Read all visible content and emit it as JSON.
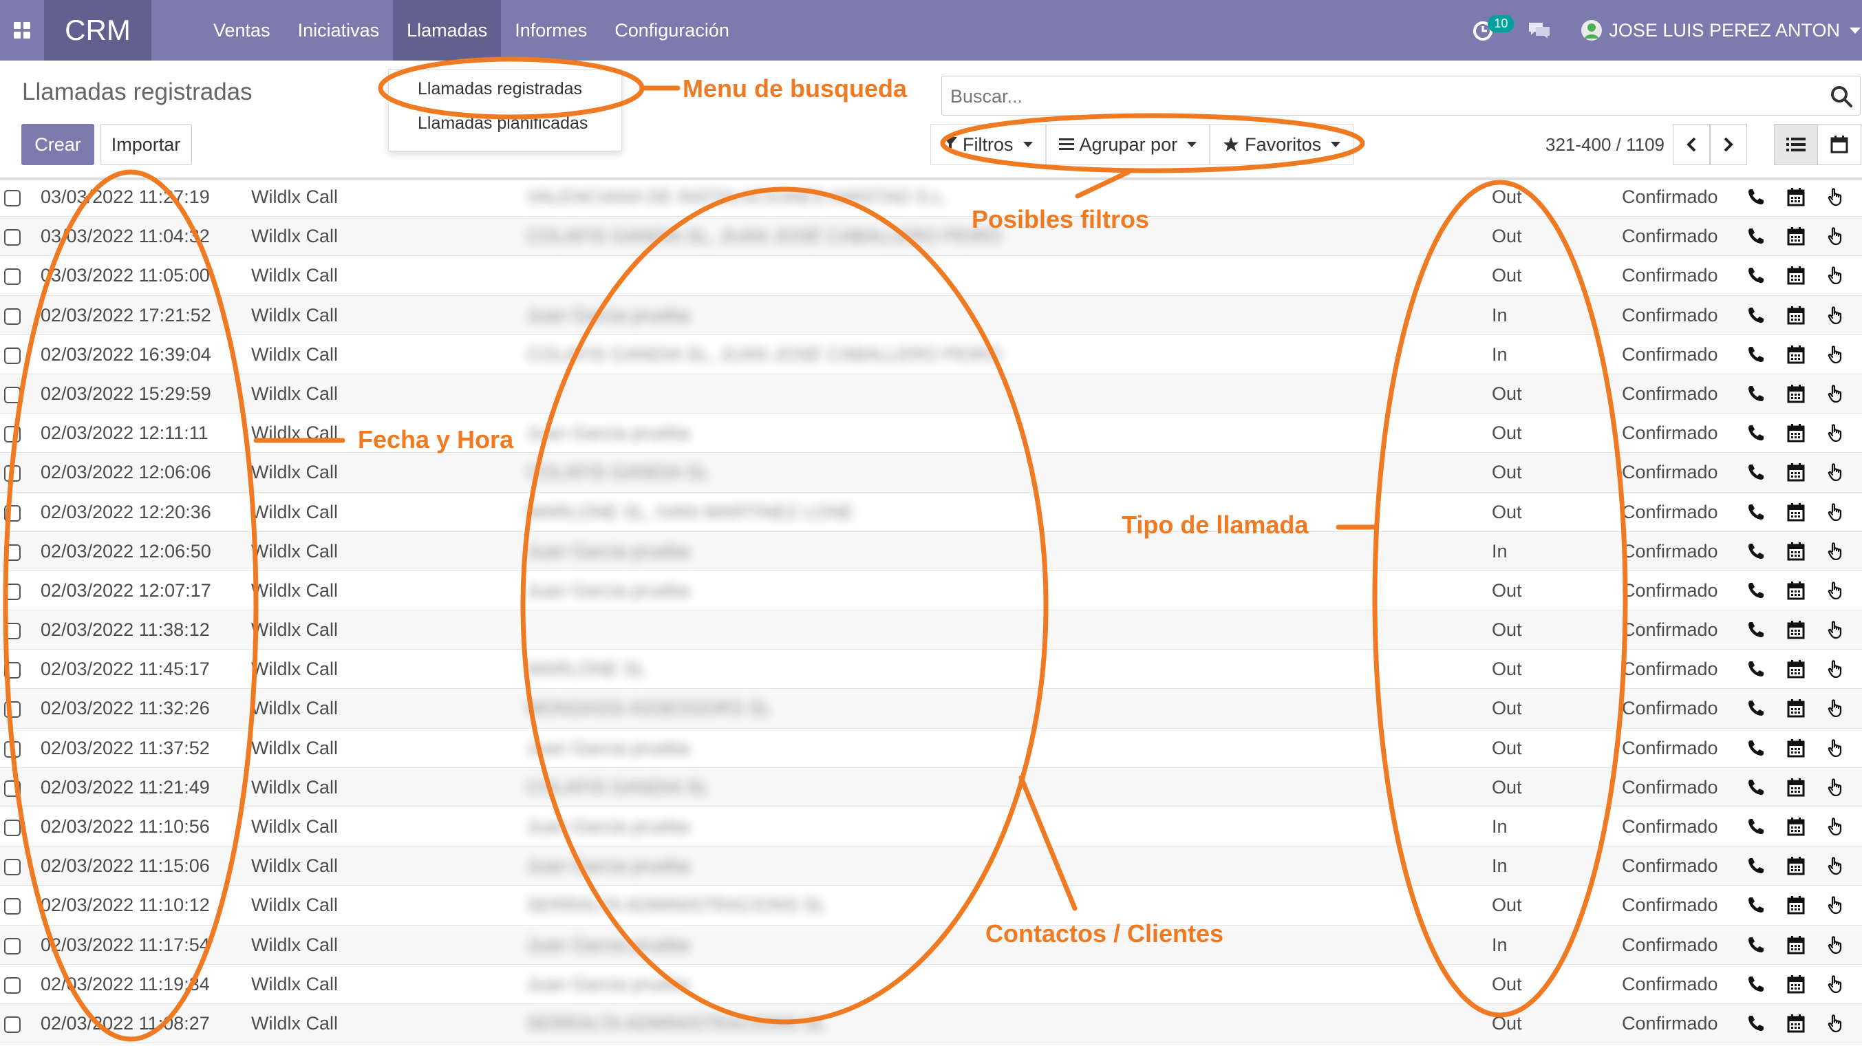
{
  "navbar": {
    "brand": "CRM",
    "menu": [
      {
        "label": "Ventas"
      },
      {
        "label": "Iniciativas"
      },
      {
        "label": "Llamadas"
      },
      {
        "label": "Informes"
      },
      {
        "label": "Configuración"
      }
    ],
    "activity_count": "10",
    "user_name": "JOSE LUIS PEREZ ANTON"
  },
  "dropdown": {
    "items": [
      {
        "label": "Llamadas registradas"
      },
      {
        "label": "Llamadas planificadas"
      }
    ]
  },
  "control": {
    "breadcrumb": "Llamadas registradas",
    "create_label": "Crear",
    "import_label": "Importar",
    "search_placeholder": "Buscar...",
    "filters_label": "Filtros",
    "groupby_label": "Agrupar por",
    "favorites_label": "Favoritos",
    "pager_value": "321-400 / 1109"
  },
  "rows": [
    {
      "date": "03/03/2022 11:27:19",
      "type": "Wildlx Call",
      "contact": "VALENCIANA DE INSTALACIONES AMISTAD S.L.",
      "direction": "Out",
      "state": "Confirmado"
    },
    {
      "date": "03/03/2022 11:04:32",
      "type": "Wildlx Call",
      "contact": "COLAFIS GANDIA SL, JUAN JOSÉ CABALLERO PEIRÓ",
      "direction": "Out",
      "state": "Confirmado"
    },
    {
      "date": "03/03/2022 11:05:00",
      "type": "Wildlx Call",
      "contact": "",
      "direction": "Out",
      "state": "Confirmado"
    },
    {
      "date": "02/03/2022 17:21:52",
      "type": "Wildlx Call",
      "contact": "Juan Garcia prueba",
      "direction": "In",
      "state": "Confirmado"
    },
    {
      "date": "02/03/2022 16:39:04",
      "type": "Wildlx Call",
      "contact": "COLAFIS GANDIA SL, JUAN JOSÉ CABALLERO PEIRÓ",
      "direction": "In",
      "state": "Confirmado"
    },
    {
      "date": "02/03/2022 15:29:59",
      "type": "Wildlx Call",
      "contact": "",
      "direction": "Out",
      "state": "Confirmado"
    },
    {
      "date": "02/03/2022 12:11:11",
      "type": "Wildlx Call",
      "contact": "Juan Garcia prueba",
      "direction": "Out",
      "state": "Confirmado"
    },
    {
      "date": "02/03/2022 12:06:06",
      "type": "Wildlx Call",
      "contact": "COLAFIS GANDIA SL",
      "direction": "Out",
      "state": "Confirmado"
    },
    {
      "date": "02/03/2022 12:20:36",
      "type": "Wildlx Call",
      "contact": "MARLONE SL, IVAN MARTINEZ LONE",
      "direction": "Out",
      "state": "Confirmado"
    },
    {
      "date": "02/03/2022 12:06:50",
      "type": "Wildlx Call",
      "contact": "Juan Garcia prueba",
      "direction": "In",
      "state": "Confirmado"
    },
    {
      "date": "02/03/2022 12:07:17",
      "type": "Wildlx Call",
      "contact": "Juan Garcia prueba",
      "direction": "Out",
      "state": "Confirmado"
    },
    {
      "date": "02/03/2022 11:38:12",
      "type": "Wildlx Call",
      "contact": "",
      "direction": "Out",
      "state": "Confirmado"
    },
    {
      "date": "02/03/2022 11:45:17",
      "type": "Wildlx Call",
      "contact": "MARLONE SL",
      "direction": "Out",
      "state": "Confirmado"
    },
    {
      "date": "02/03/2022 11:32:26",
      "type": "Wildlx Call",
      "contact": "MONSASSI ASSESSORS SL",
      "direction": "Out",
      "state": "Confirmado"
    },
    {
      "date": "02/03/2022 11:37:52",
      "type": "Wildlx Call",
      "contact": "Juan Garcia prueba",
      "direction": "Out",
      "state": "Confirmado"
    },
    {
      "date": "02/03/2022 11:21:49",
      "type": "Wildlx Call",
      "contact": "COLAFIS GANDIA SL",
      "direction": "Out",
      "state": "Confirmado"
    },
    {
      "date": "02/03/2022 11:10:56",
      "type": "Wildlx Call",
      "contact": "Juan Garcia prueba",
      "direction": "In",
      "state": "Confirmado"
    },
    {
      "date": "02/03/2022 11:15:06",
      "type": "Wildlx Call",
      "contact": "Juan Garcia prueba",
      "direction": "In",
      "state": "Confirmado"
    },
    {
      "date": "02/03/2022 11:10:12",
      "type": "Wildlx Call",
      "contact": "SERRALTA ADMINISTRACIONS SL",
      "direction": "Out",
      "state": "Confirmado"
    },
    {
      "date": "02/03/2022 11:17:54",
      "type": "Wildlx Call",
      "contact": "Juan Garcia prueba",
      "direction": "In",
      "state": "Confirmado"
    },
    {
      "date": "02/03/2022 11:19:34",
      "type": "Wildlx Call",
      "contact": "Juan Garcia prueba",
      "direction": "Out",
      "state": "Confirmado"
    },
    {
      "date": "02/03/2022 11:08:27",
      "type": "Wildlx Call",
      "contact": "SERRALTA ADMINISTRACIONS SL",
      "direction": "Out",
      "state": "Confirmado"
    }
  ],
  "annotations": {
    "menu": "Menu de busqueda",
    "filters": "Posibles filtros",
    "datetime": "Fecha y Hora",
    "call_type": "Tipo de llamada",
    "contacts": "Contactos / Clientes"
  },
  "colors": {
    "navbar": "#7c7bad",
    "brand_bg": "#62608f",
    "primary_button": "#7c7bad",
    "annotation": "#f07a22"
  },
  "icons": [
    "apps-grid-icon",
    "activity-clock-icon",
    "chat-icon",
    "user-avatar-icon",
    "search-icon",
    "filter-icon",
    "group-by-icon",
    "star-icon",
    "chevron-left-icon",
    "chevron-right-icon",
    "list-view-icon",
    "calendar-view-icon",
    "phone-icon",
    "calendar-icon",
    "hand-pointer-icon"
  ]
}
